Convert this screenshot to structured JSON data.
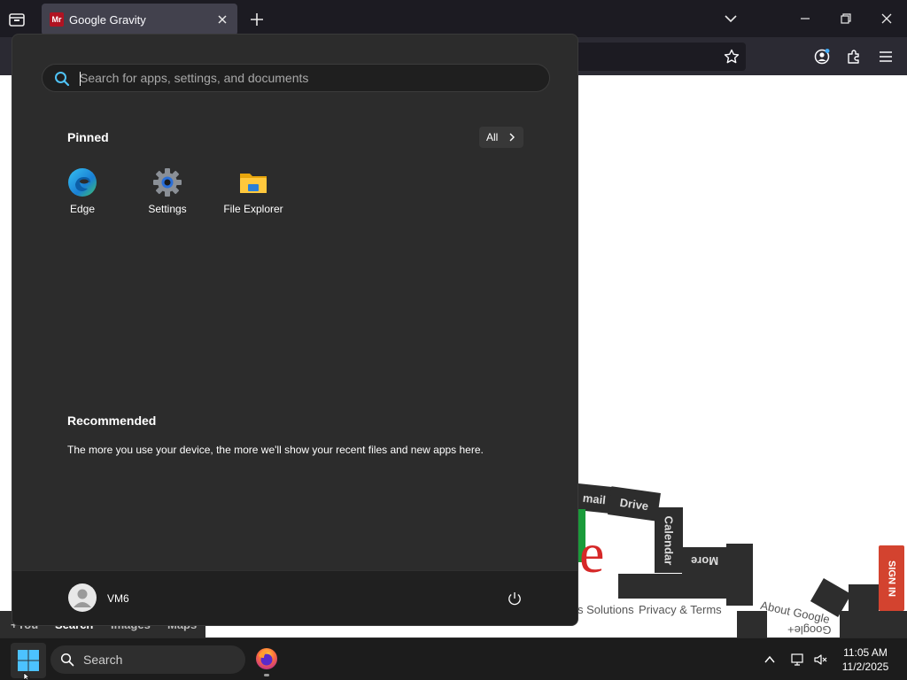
{
  "browser": {
    "tab": {
      "title": "Google Gravity",
      "favicon_text": "Mr"
    },
    "icons": [
      "tab-list-icon",
      "close-icon",
      "plus-icon",
      "chevron-down-icon",
      "minimize-icon",
      "restore-icon",
      "close-window-icon",
      "star-icon",
      "account-icon",
      "extensions-icon",
      "menu-icon"
    ]
  },
  "page": {
    "gbar_links": [
      "+You",
      "Search",
      "Images",
      "Maps"
    ],
    "blocks": {
      "gmail": "mail",
      "drive": "Drive",
      "calendar": "Calendar",
      "more": "More"
    },
    "footer_links": {
      "business": "s Solutions",
      "privacy": "Privacy & Terms",
      "about": "About Google",
      "gplus": "Google+"
    },
    "logo_letter": "e",
    "sign_in": "SIGN IN"
  },
  "start_menu": {
    "search_placeholder": "Search for apps, settings, and documents",
    "pinned_title": "Pinned",
    "all_button": "All",
    "pinned_apps": [
      {
        "name": "Edge",
        "icon": "edge-icon"
      },
      {
        "name": "Settings",
        "icon": "settings-gear-icon"
      },
      {
        "name": "File Explorer",
        "icon": "folder-icon"
      }
    ],
    "recommended_title": "Recommended",
    "recommended_text": "The more you use your device, the more we'll show your recent files and new apps here.",
    "user_name": "VM6"
  },
  "taskbar": {
    "search_label": "Search",
    "time": "11:05 AM",
    "date": "11/2/2025",
    "accent": "#0078d4"
  }
}
